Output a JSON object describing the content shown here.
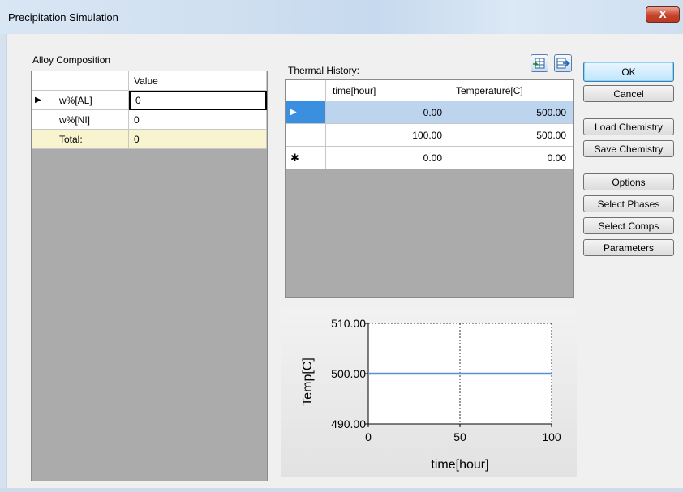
{
  "window": {
    "title": "Precipitation Simulation",
    "close_glyph": "X"
  },
  "alloy": {
    "section_label": "Alloy Composition",
    "value_header": "Value",
    "row_indicator": "▶",
    "rows": [
      {
        "name": "w%[AL]",
        "value": "0"
      },
      {
        "name": "w%[NI]",
        "value": "0"
      }
    ],
    "total": {
      "name": "Total:",
      "value": "0"
    }
  },
  "thermal": {
    "section_label": "Thermal History:",
    "headers": {
      "time": "time[hour]",
      "temperature": "Temperature[C]"
    },
    "rows": [
      {
        "indicator": "▶",
        "time": "0.00",
        "temperature": "500.00"
      },
      {
        "indicator": "",
        "time": "100.00",
        "temperature": "500.00"
      },
      {
        "indicator": "✱",
        "time": "0.00",
        "temperature": "0.00"
      }
    ],
    "icons": [
      "import-table-icon",
      "export-table-icon"
    ]
  },
  "buttons": {
    "ok": "OK",
    "cancel": "Cancel",
    "load_chemistry": "Load Chemistry",
    "save_chemistry": "Save Chemistry",
    "options": "Options",
    "select_phases": "Select Phases",
    "select_comps": "Select Comps",
    "parameters": "Parameters"
  },
  "chart_data": {
    "type": "line",
    "xlabel": "time[hour]",
    "ylabel": "Temp[C]",
    "xlim": [
      0,
      100
    ],
    "ylim": [
      490,
      510
    ],
    "x_ticks": [
      "0",
      "50",
      "100"
    ],
    "y_ticks": [
      "510.00",
      "500.00",
      "490.00"
    ],
    "series": [
      {
        "x": [
          0,
          100
        ],
        "y": [
          500,
          500
        ],
        "color": "#5b8fdc"
      }
    ],
    "grid": true
  }
}
